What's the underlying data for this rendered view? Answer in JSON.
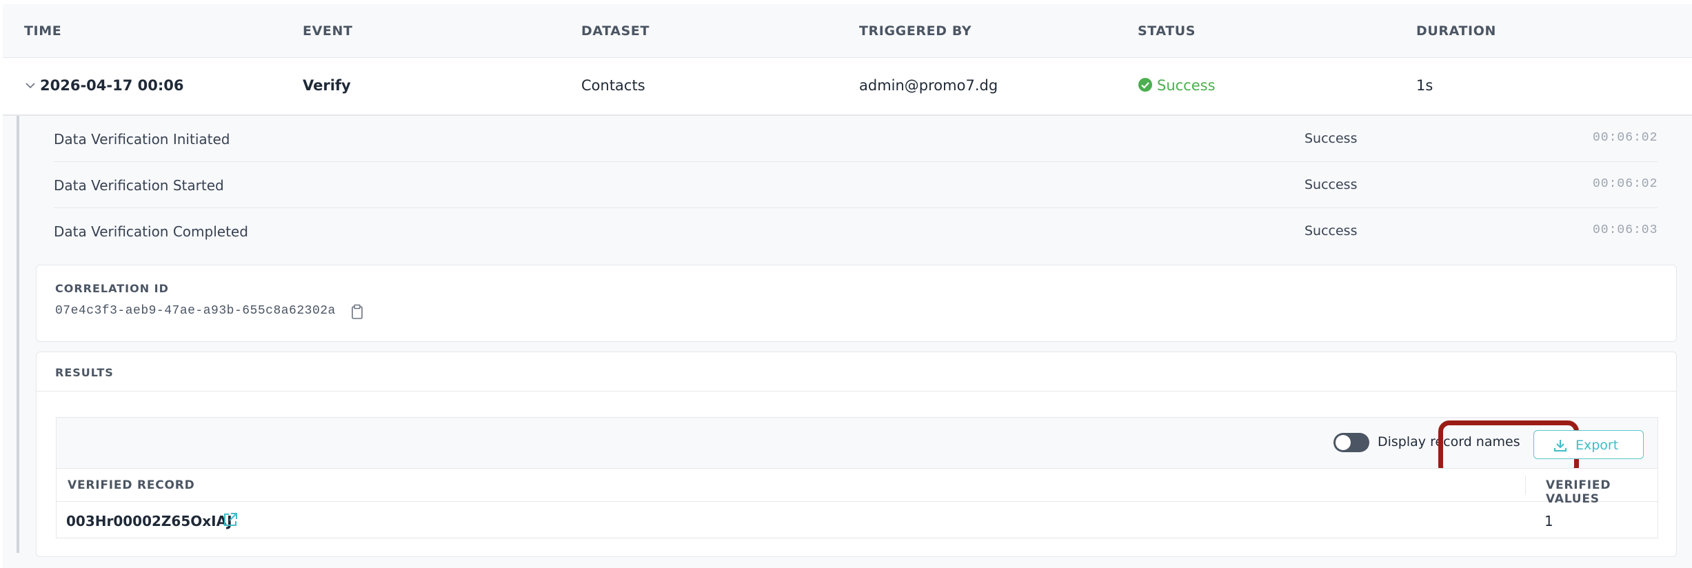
{
  "columns": [
    "TIME",
    "EVENT",
    "DATASET",
    "TRIGGERED BY",
    "STATUS",
    "DURATION"
  ],
  "event": {
    "time": "2026-04-17 00:06",
    "event": "Verify",
    "dataset": "Contacts",
    "triggered_by": "admin@promo7.dg",
    "status": "Success",
    "duration": "1s"
  },
  "steps": [
    {
      "label": "Data Verification Initiated",
      "status": "Success",
      "time": "00:06:02"
    },
    {
      "label": "Data Verification Started",
      "status": "Success",
      "time": "00:06:02"
    },
    {
      "label": "Data Verification Completed",
      "status": "Success",
      "time": "00:06:03"
    }
  ],
  "correlation": {
    "title": "CORRELATION ID",
    "id": "07e4c3f3-aeb9-47ae-a93b-655c8a62302a"
  },
  "results": {
    "title": "RESULTS",
    "toggle_label": "Display record names",
    "export_label": "Export",
    "headers": [
      "VERIFIED RECORD",
      "VERIFIED VALUES"
    ],
    "rows": [
      {
        "record": "003Hr00002Z65OxIAJ",
        "values": "1"
      }
    ]
  },
  "colors": {
    "success": "#4caf50",
    "accent": "#3dbec4",
    "highlight": "#9b1c15"
  }
}
